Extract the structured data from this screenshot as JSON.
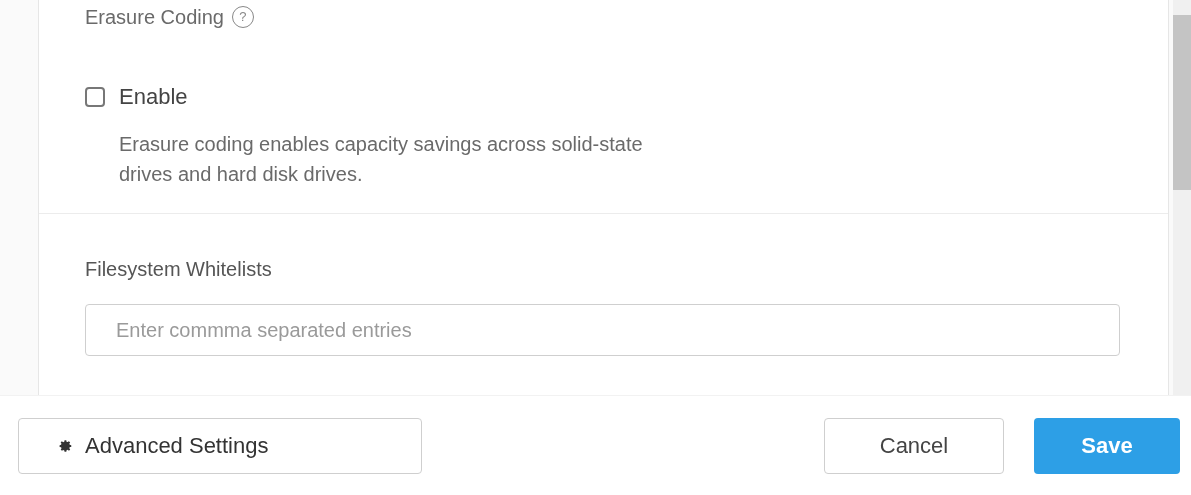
{
  "erasure_coding": {
    "title": "Erasure Coding",
    "help_icon": "?",
    "checkbox": {
      "label": "Enable",
      "checked": false
    },
    "description": "Erasure coding enables capacity savings across solid-state drives and hard disk drives."
  },
  "filesystem_whitelists": {
    "label": "Filesystem Whitelists",
    "placeholder": "Enter commma separated entries"
  },
  "footer": {
    "advanced_button": "Advanced Settings",
    "cancel_button": "Cancel",
    "save_button": "Save"
  }
}
